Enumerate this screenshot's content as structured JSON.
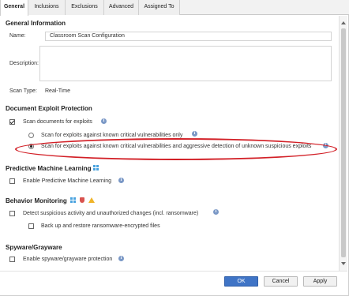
{
  "tabs": [
    {
      "label": "General",
      "active": true
    },
    {
      "label": "Inclusions",
      "active": false
    },
    {
      "label": "Exclusions",
      "active": false
    },
    {
      "label": "Advanced",
      "active": false
    },
    {
      "label": "Assigned To",
      "active": false
    }
  ],
  "general_info": {
    "title": "General Information",
    "name_label": "Name:",
    "name_value": "Classroom Scan Configuration",
    "description_label": "Description:",
    "description_value": "",
    "scan_type_label": "Scan Type:",
    "scan_type_value": "Real-Time"
  },
  "document_exploit": {
    "title": "Document Exploit Protection",
    "scan_documents_label": "Scan documents for exploits",
    "scan_documents_checked": true,
    "option_critical_label": "Scan for exploits against known critical vulnerabilities only",
    "option_critical_selected": false,
    "option_aggressive_label": "Scan for exploits against known critical vulnerabilities and aggressive detection of unknown suspicious exploits",
    "option_aggressive_selected": true
  },
  "predictive_ml": {
    "title": "Predictive Machine Learning",
    "enable_label": "Enable Predictive Machine Learning",
    "enabled": false
  },
  "behavior_monitoring": {
    "title": "Behavior Monitoring",
    "detect_label": "Detect suspicious activity and unauthorized changes (incl. ransomware)",
    "detect_checked": false,
    "backup_label": "Back up and restore ransomware-encrypted files",
    "backup_checked": false
  },
  "spyware": {
    "title": "Spyware/Grayware",
    "enable_label": "Enable spyware/grayware protection",
    "enabled": false
  },
  "buttons": {
    "ok": "OK",
    "cancel": "Cancel",
    "apply": "Apply"
  },
  "colors": {
    "primary_button": "#3f74c6",
    "info_icon": "#7a98c6",
    "annotation": "#d21f26"
  }
}
